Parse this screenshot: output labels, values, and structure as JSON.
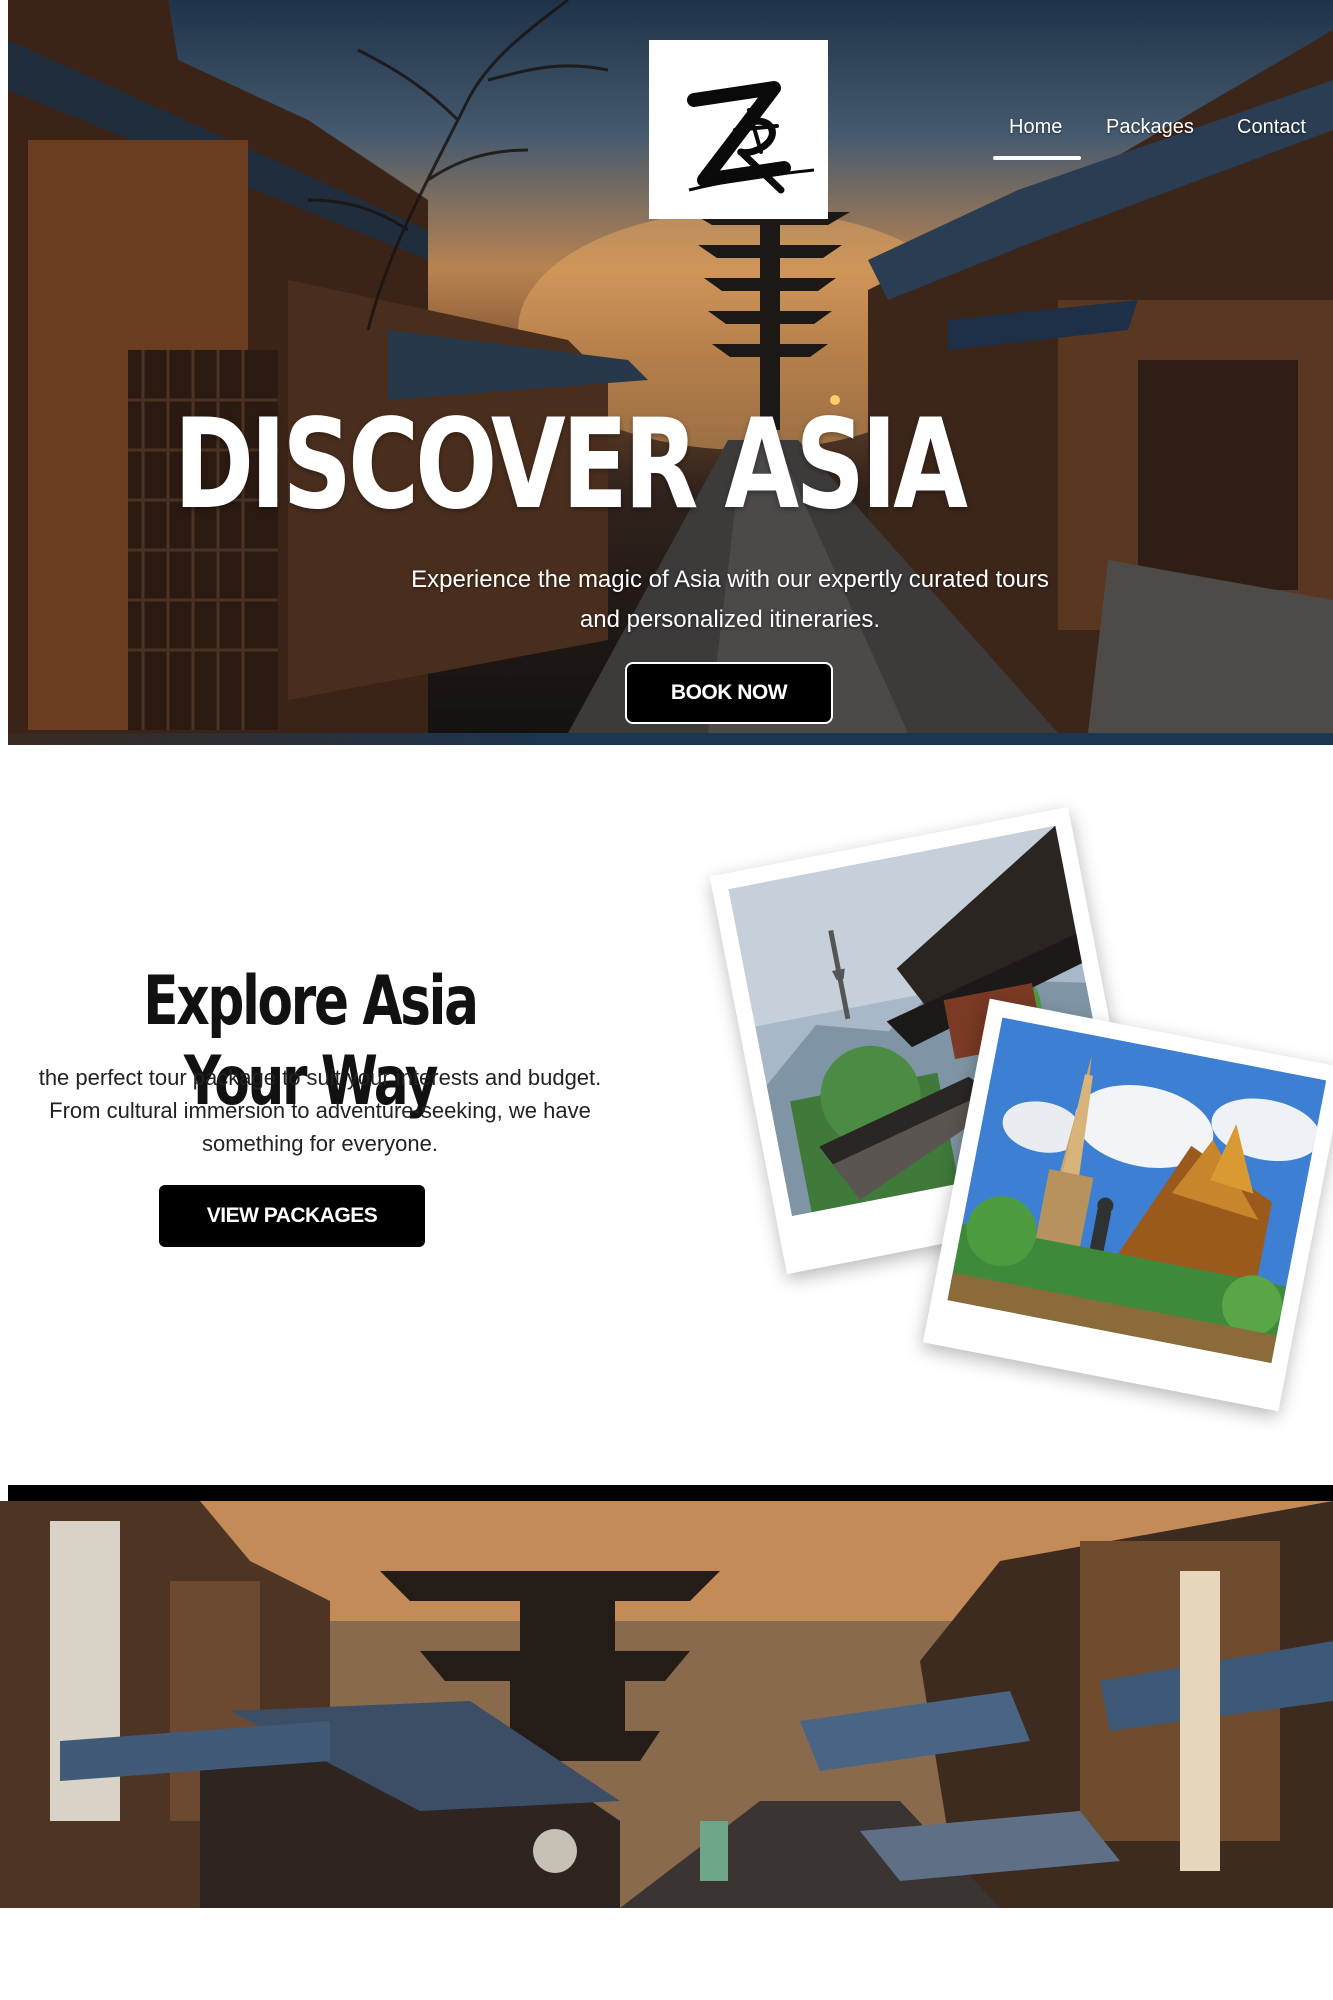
{
  "nav": {
    "items": [
      {
        "label": "Home",
        "active": true
      },
      {
        "label": "Packages",
        "active": false
      },
      {
        "label": "Contact",
        "active": false
      }
    ]
  },
  "logo": {
    "alt": "ZR logo"
  },
  "hero": {
    "title": "DISCOVER ASIA",
    "subtitle_line1": "Experience the magic of Asia with our expertly curated tours",
    "subtitle_line2": "and personalized itineraries.",
    "cta": "BOOK NOW"
  },
  "explore": {
    "title": "Explore Asia Your Way",
    "text_line1": "the perfect tour package to suit your interests and budget.",
    "text_line2": "From cultural immersion to adventure-seeking, we have",
    "text_line3": "something for everyone.",
    "cta": "VIEW PACKAGES"
  },
  "colors": {
    "button_bg": "#000000",
    "button_text": "#ffffff",
    "accent_white": "#ffffff"
  }
}
